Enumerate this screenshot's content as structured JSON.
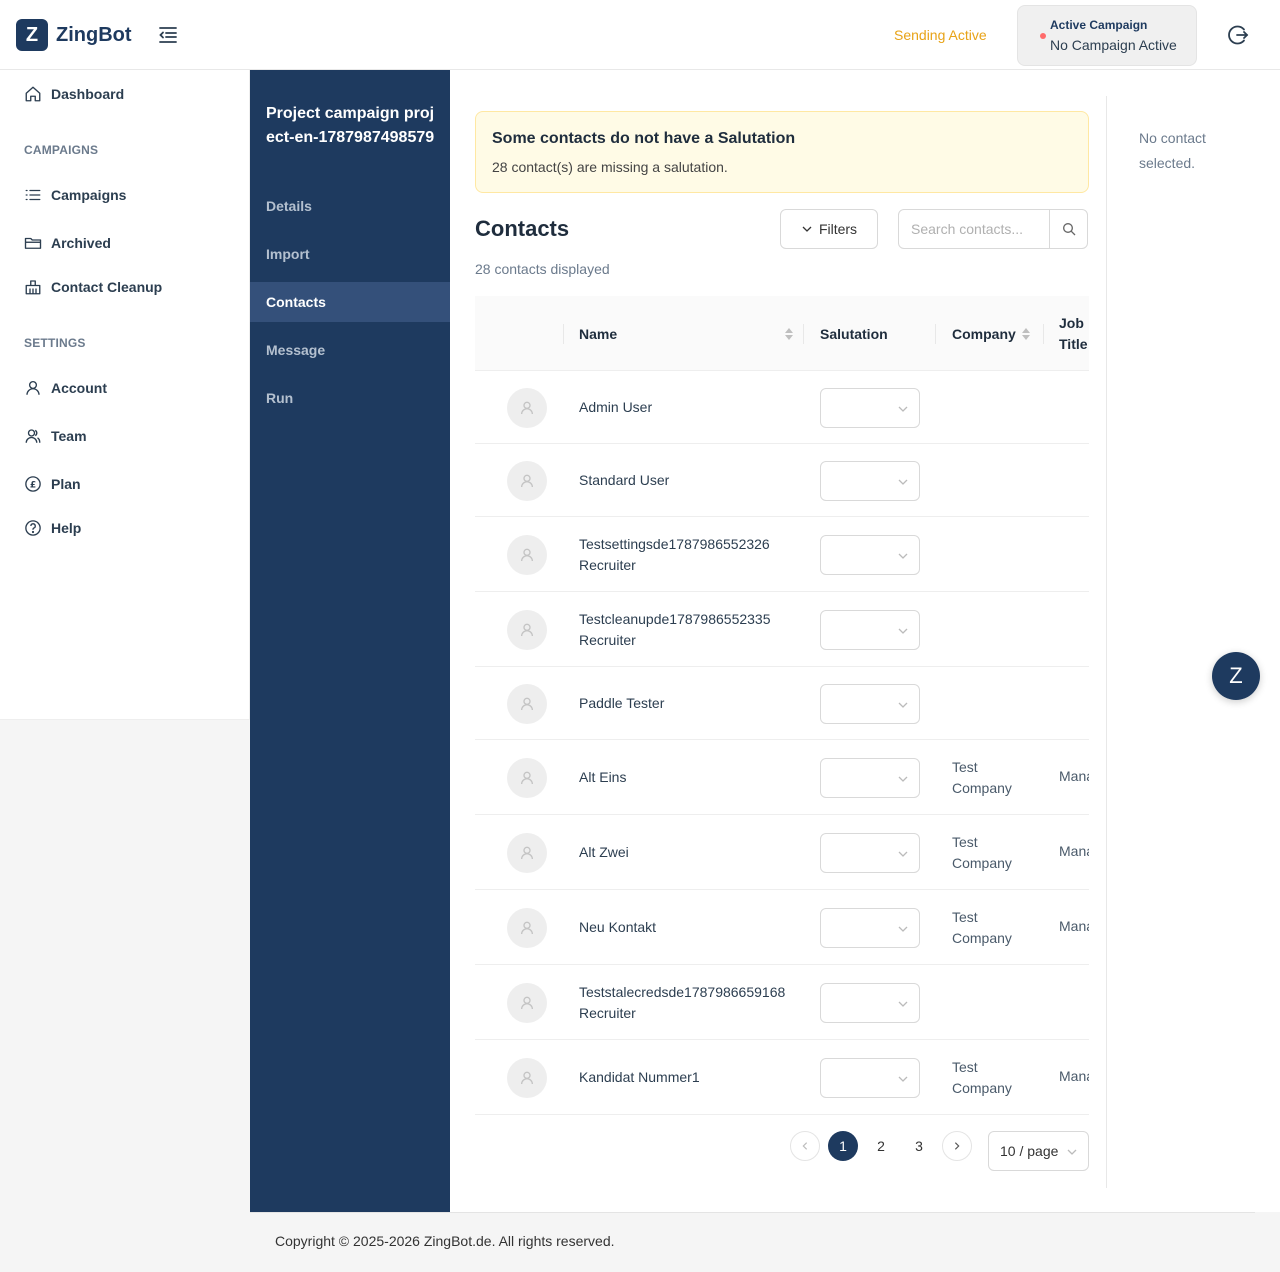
{
  "header": {
    "logo_letter": "Z",
    "brand": "ZingBot",
    "sending_status": "Sending Active",
    "campaign_label": "Active Campaign",
    "campaign_value": "No Campaign Active"
  },
  "sidebar": {
    "dashboard": "Dashboard",
    "section_campaigns": "CAMPAIGNS",
    "campaigns": "Campaigns",
    "archived": "Archived",
    "contact_cleanup": "Contact Cleanup",
    "section_settings": "SETTINGS",
    "account": "Account",
    "team": "Team",
    "plan": "Plan",
    "help": "Help"
  },
  "project": {
    "title": "Project campaign project-en-1787987498579",
    "nav": [
      "Details",
      "Import",
      "Contacts",
      "Message",
      "Run"
    ],
    "active": "Contacts"
  },
  "alert": {
    "title": "Some contacts do not have a Salutation",
    "description": "28 contact(s) are missing a salutation."
  },
  "contacts": {
    "title": "Contacts",
    "filters_label": "Filters",
    "search_placeholder": "Search contacts...",
    "displayed": "28 contacts displayed",
    "columns": {
      "name": "Name",
      "salutation": "Salutation",
      "company": "Company",
      "job_title": "Job Title"
    },
    "rows": [
      {
        "name": "Admin User",
        "company": "",
        "job": ""
      },
      {
        "name": "Standard User",
        "company": "",
        "job": ""
      },
      {
        "name": "Testsettingsde1787986552326 Recruiter",
        "company": "",
        "job": ""
      },
      {
        "name": "Testcleanupde1787986552335 Recruiter",
        "company": "",
        "job": ""
      },
      {
        "name": "Paddle Tester",
        "company": "",
        "job": ""
      },
      {
        "name": "Alt Eins",
        "company": "Test Company",
        "job": "Manager"
      },
      {
        "name": "Alt Zwei",
        "company": "Test Company",
        "job": "Manager"
      },
      {
        "name": "Neu Kontakt",
        "company": "Test Company",
        "job": "Manager"
      },
      {
        "name": "Teststalecredsde1787986659168 Recruiter",
        "company": "",
        "job": ""
      },
      {
        "name": "Kandidat Nummer1",
        "company": "Test Company",
        "job": "Manager"
      }
    ]
  },
  "pagination": {
    "pages": [
      "1",
      "2",
      "3"
    ],
    "current": "1",
    "page_size": "10 / page"
  },
  "right_panel": {
    "empty_text": "No contact selected."
  },
  "fab_letter": "Z",
  "footer": "Copyright © 2025-2026 ZingBot.de. All rights reserved."
}
